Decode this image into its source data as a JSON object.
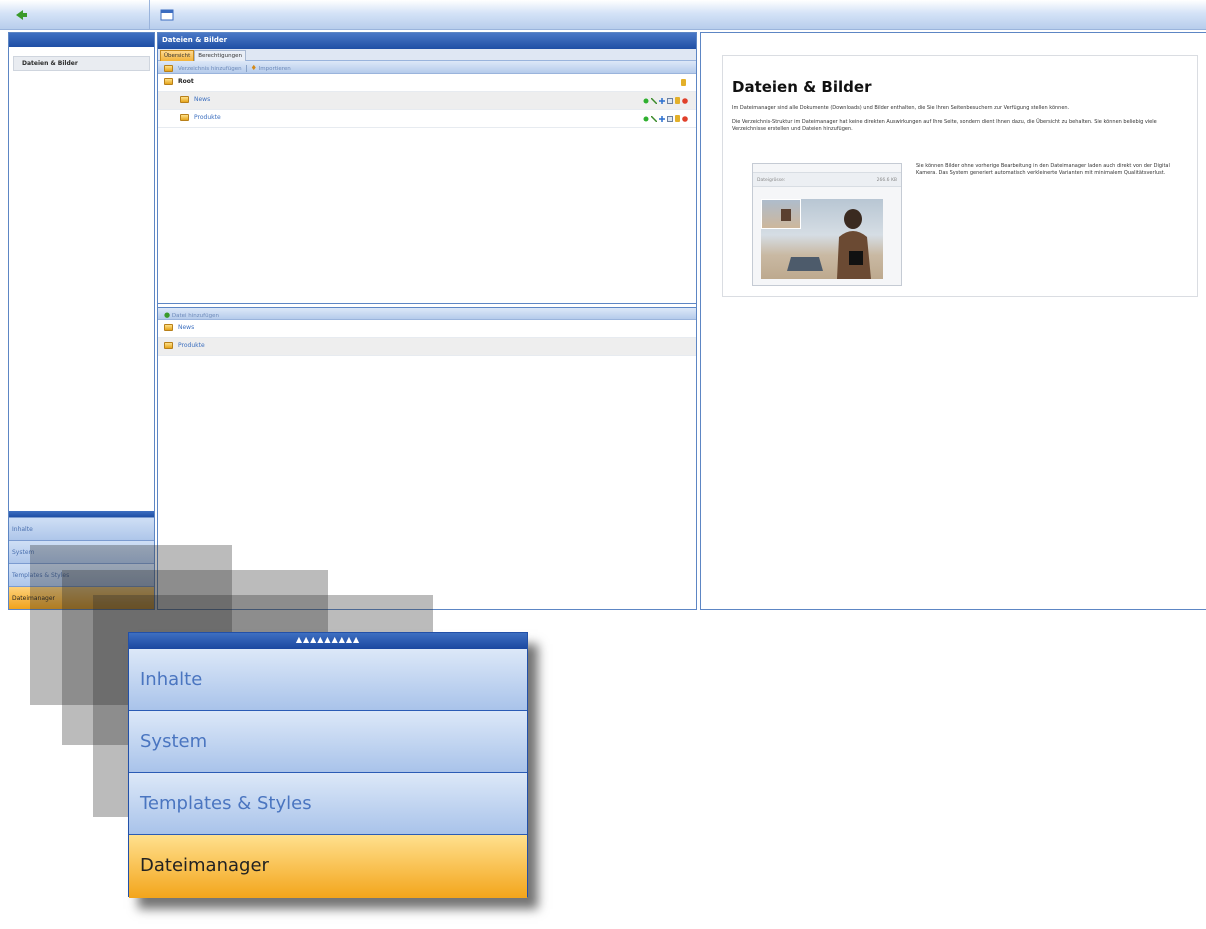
{
  "sidebar": {
    "tree_item": "Dateien & Bilder",
    "nav": [
      "Inhalte",
      "System",
      "Templates & Styles",
      "Dateimanager"
    ]
  },
  "main": {
    "title": "Dateien & Bilder",
    "tabs": [
      "Übersicht",
      "Berechtigungen"
    ],
    "toolbar": {
      "add_folder": "Verzeichnis hinzufügen",
      "import": "Importieren"
    },
    "tree": {
      "root": "Root",
      "folders": [
        "News",
        "Produkte"
      ]
    },
    "files_toolbar": {
      "add_file": "Datei hinzufügen"
    },
    "files": [
      "News",
      "Produkte"
    ]
  },
  "help": {
    "title": "Dateien & Bilder",
    "p1": "Im Dateimanager sind alle Dokumente (Downloads) und Bilder enthalten, die Sie Ihren Seitenbesuchern zur Verfügung stellen können.",
    "p2": "Die Verzeichnis-Struktur im Dateimanager hat keine direkten Auswirkungen auf Ihre Seite, sondern dient Ihnen dazu, die Übersicht zu behalten. Sie können beliebig viele Verzeichnisse erstellen und Dateien hinzufügen.",
    "p3": "Sie können Bilder ohne vorherige Bearbeitung in den Dateimanager laden auch direkt von der Digital Kamera. Das System generiert automatisch verkleinerte Varianten mit minimalem Qualitätsverlust.",
    "thumb_label": "Dateigrösse:",
    "thumb_value": "266.6 KB"
  },
  "zoom": {
    "grip": "▲▲▲▲▲▲▲▲▲",
    "nav": [
      "Inhalte",
      "System",
      "Templates & Styles",
      "Dateimanager"
    ]
  },
  "colors": {
    "accent": "#1f4fa5",
    "active": "#f3a51b"
  }
}
